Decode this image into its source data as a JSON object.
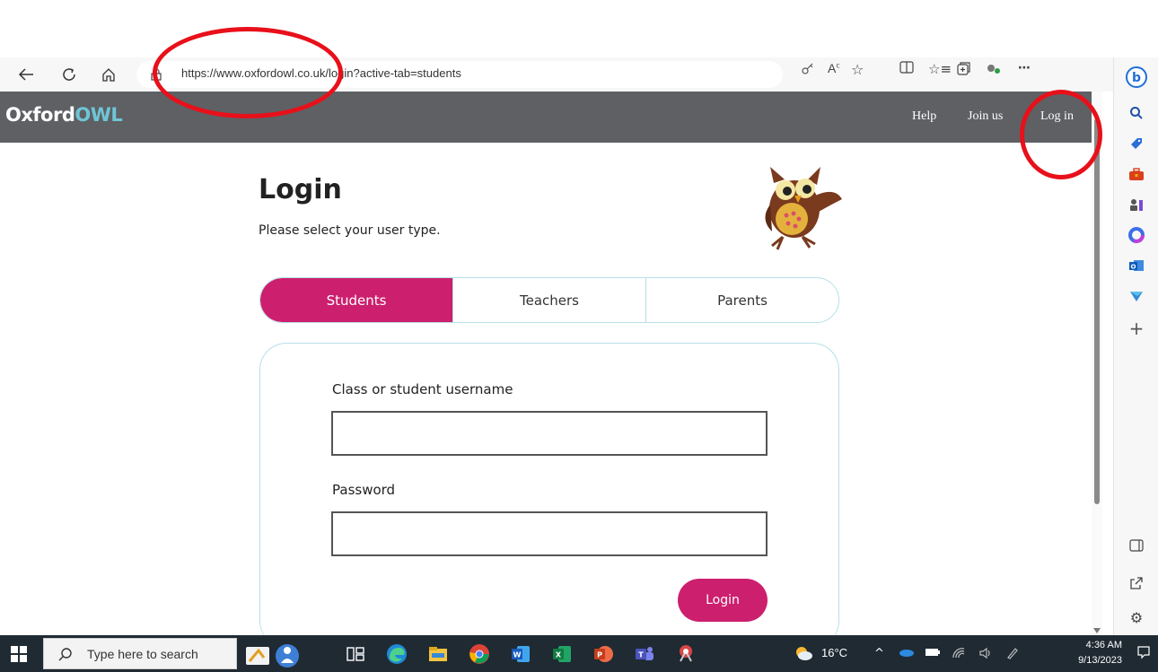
{
  "browser": {
    "url_prefix": "https://",
    "url_host": "www.oxfordowl.co.uk",
    "url_path": "/login?active-tab=students"
  },
  "site": {
    "logo_part1": "Oxford",
    "logo_part2": "OWL",
    "nav": {
      "help": "Help",
      "join": "Join us",
      "login": "Log in"
    }
  },
  "page": {
    "title": "Login",
    "subtitle": "Please select your user type.",
    "tabs": [
      {
        "label": "Students",
        "active": true
      },
      {
        "label": "Teachers",
        "active": false
      },
      {
        "label": "Parents",
        "active": false
      }
    ],
    "fields": {
      "username_label": "Class or student username",
      "username_value": "",
      "password_label": "Password",
      "password_value": ""
    },
    "submit_label": "Login"
  },
  "taskbar": {
    "search_placeholder": "Type here to search",
    "weather_temp": "16°C",
    "time": "4:36 AM",
    "date": "9/13/2023"
  },
  "colors": {
    "brand_pink": "#cc1f6e",
    "header_gray": "#5e6064",
    "owl_teal": "#6ec5d5",
    "annotation_red": "#e8101a"
  },
  "icons": {
    "browser_nav": [
      "back-arrow-icon",
      "refresh-icon",
      "home-icon"
    ],
    "sidebar": [
      "bing-copilot-icon",
      "search-icon",
      "shopping-tag-icon",
      "tools-briefcase-icon",
      "games-icon",
      "microsoft-365-icon",
      "outlook-icon",
      "send-icon",
      "add-icon",
      "sidebar-toggle-icon",
      "external-link-icon",
      "settings-gear-icon"
    ]
  }
}
